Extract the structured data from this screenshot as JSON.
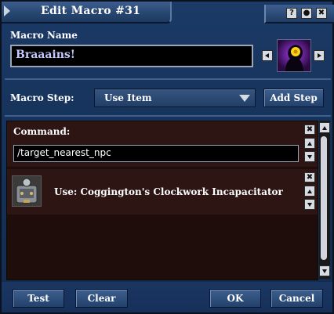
{
  "window": {
    "title": "Edit Macro #31",
    "title_buttons": [
      "?",
      "●",
      "✖"
    ]
  },
  "macro_name": {
    "label": "Macro Name",
    "value": "Braaains!"
  },
  "macro_step": {
    "label": "Macro Step:",
    "selected": "Use Item",
    "add_step_label": "Add Step"
  },
  "steps": [
    {
      "label": "Command:",
      "value": "/target_nearest_npc"
    },
    {
      "label": "Use: Coggington's Clockwork Incapacitator"
    }
  ],
  "footer": {
    "test_label": "Test",
    "clear_label": "Clear",
    "ok_label": "OK",
    "cancel_label": "Cancel"
  },
  "colors": {
    "window_bg": "#1a3660",
    "steps_bg": "#2c1513",
    "name_text": "#c6c9ff"
  }
}
